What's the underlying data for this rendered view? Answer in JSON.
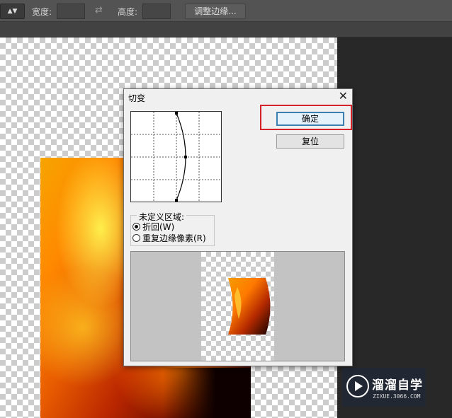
{
  "options_bar": {
    "width_label": "宽度:",
    "height_label": "高度:",
    "swap_icon": "swap-arrows-icon",
    "refine_edge_label": "调整边缘..."
  },
  "dialog": {
    "title": "切变",
    "close_icon": "close-icon",
    "ok_label": "确定",
    "reset_label": "复位",
    "undefined_area_label": "未定义区域:",
    "options": [
      {
        "label": "折回(W)",
        "selected": true
      },
      {
        "label": "重复边缘像素(R)",
        "selected": false
      }
    ]
  },
  "watermark": {
    "brand": "溜溜自学",
    "url": "ZIXUE.3066.COM",
    "icon": "play-circle-icon"
  },
  "colors": {
    "highlight": "#d6212a",
    "default_button_border": "#3c7fb1"
  }
}
